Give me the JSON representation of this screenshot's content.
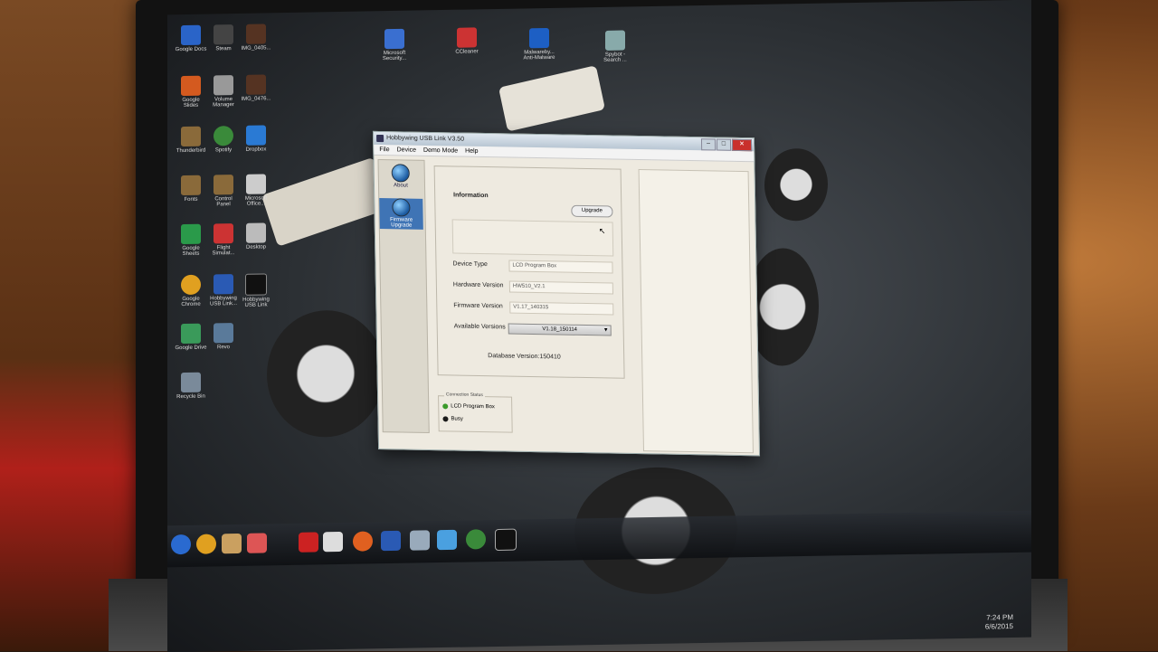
{
  "desktop": {
    "icons_top": [
      "Microsoft Security...",
      "CCleaner",
      "Malwareby... Anti-Malware",
      "Spybot - Search ..."
    ],
    "icons_left": [
      "Google Docs",
      "Steam",
      "IMG_0405...",
      "Google Slides",
      "Volume Manager",
      "IMG_0476...",
      "Thunderbird",
      "Spotify",
      "Dropbox",
      "Fonts",
      "Control Panel",
      "Microsoft Office...",
      "Google Sheets",
      "Flight Simulat...",
      "Desktop",
      "Google Chrome",
      "Hobbywing USB Link...",
      "Hobbywing USB Link",
      "Google Drive",
      "Revo",
      "Recycle Bin"
    ]
  },
  "taskbar": {
    "clock_time": "7:24 PM",
    "clock_date": "6/6/2015"
  },
  "window": {
    "title": "Hobbywing USB Link V3.50",
    "menu": [
      "File",
      "Device",
      "Demo Mode",
      "Help"
    ],
    "nav": [
      {
        "label": "About"
      },
      {
        "label": "Firmware Upgrade"
      }
    ],
    "information_label": "Information",
    "upgrade_button": "Upgrade",
    "fields": {
      "device_type_label": "Device Type",
      "device_type_value": "LCD Program Box",
      "hardware_version_label": "Hardware Version",
      "hardware_version_value": "HW510_V2.1",
      "firmware_version_label": "Firmware Version",
      "firmware_version_value": "V1.17_140315",
      "available_versions_label": "Available Versions",
      "available_versions_selected": "V1.18_150114"
    },
    "database_version": "Database Version:150410",
    "connection_status": {
      "title": "Connection Status",
      "items": [
        {
          "label": "LCD Program Box",
          "color": "#3a9a2a"
        },
        {
          "label": "Busy",
          "color": "#1a1a1a"
        }
      ]
    }
  },
  "colors": {
    "accent": "#3f74b5",
    "close": "#c9302c"
  }
}
